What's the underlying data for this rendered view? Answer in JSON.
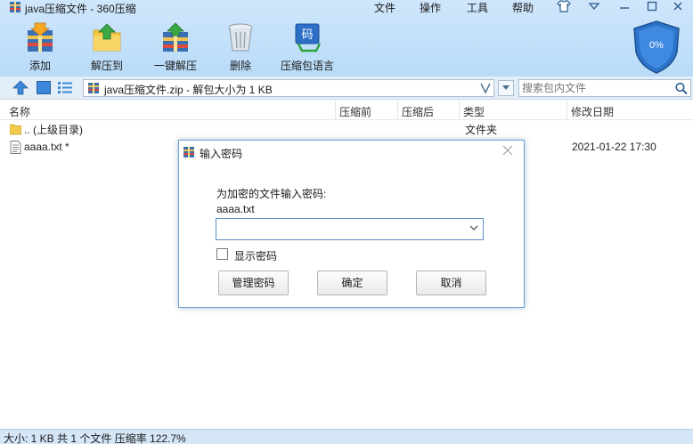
{
  "window": {
    "title": "java压缩文件 - 360压缩",
    "menus": [
      "文件",
      "操作",
      "工具",
      "帮助"
    ]
  },
  "toolbar": {
    "add": "添加",
    "extract_to": "解压到",
    "one_click_extract": "一键解压",
    "delete": "删除",
    "archive_language": "压缩包语言"
  },
  "shield": {
    "percent": "0%"
  },
  "address": {
    "path": "java压缩文件.zip - 解包大小为 1 KB",
    "search_placeholder": "搜索包内文件"
  },
  "list": {
    "columns": {
      "name": "名称",
      "before": "压缩前",
      "after": "压缩后",
      "type": "类型",
      "date": "修改日期"
    },
    "rows": [
      {
        "name": ".. (上级目录)",
        "type": "文件夹",
        "date": ""
      },
      {
        "name": "aaaa.txt *",
        "type": "",
        "date": "2021-01-22 17:30"
      }
    ]
  },
  "status": {
    "text": "大小: 1 KB 共 1 个文件 压缩率 122.7%"
  },
  "dialog": {
    "title": "输入密码",
    "prompt": "为加密的文件输入密码:",
    "filename": "aaaa.txt",
    "password_value": "",
    "show_password_label": "显示密码",
    "manage_button": "管理密码",
    "ok_button": "确定",
    "cancel_button": "取消"
  },
  "colors": {
    "toolbar_bg": "#c4e0f9",
    "dialog_border": "#6b9ccd",
    "status_bg": "#d5e6f6"
  }
}
